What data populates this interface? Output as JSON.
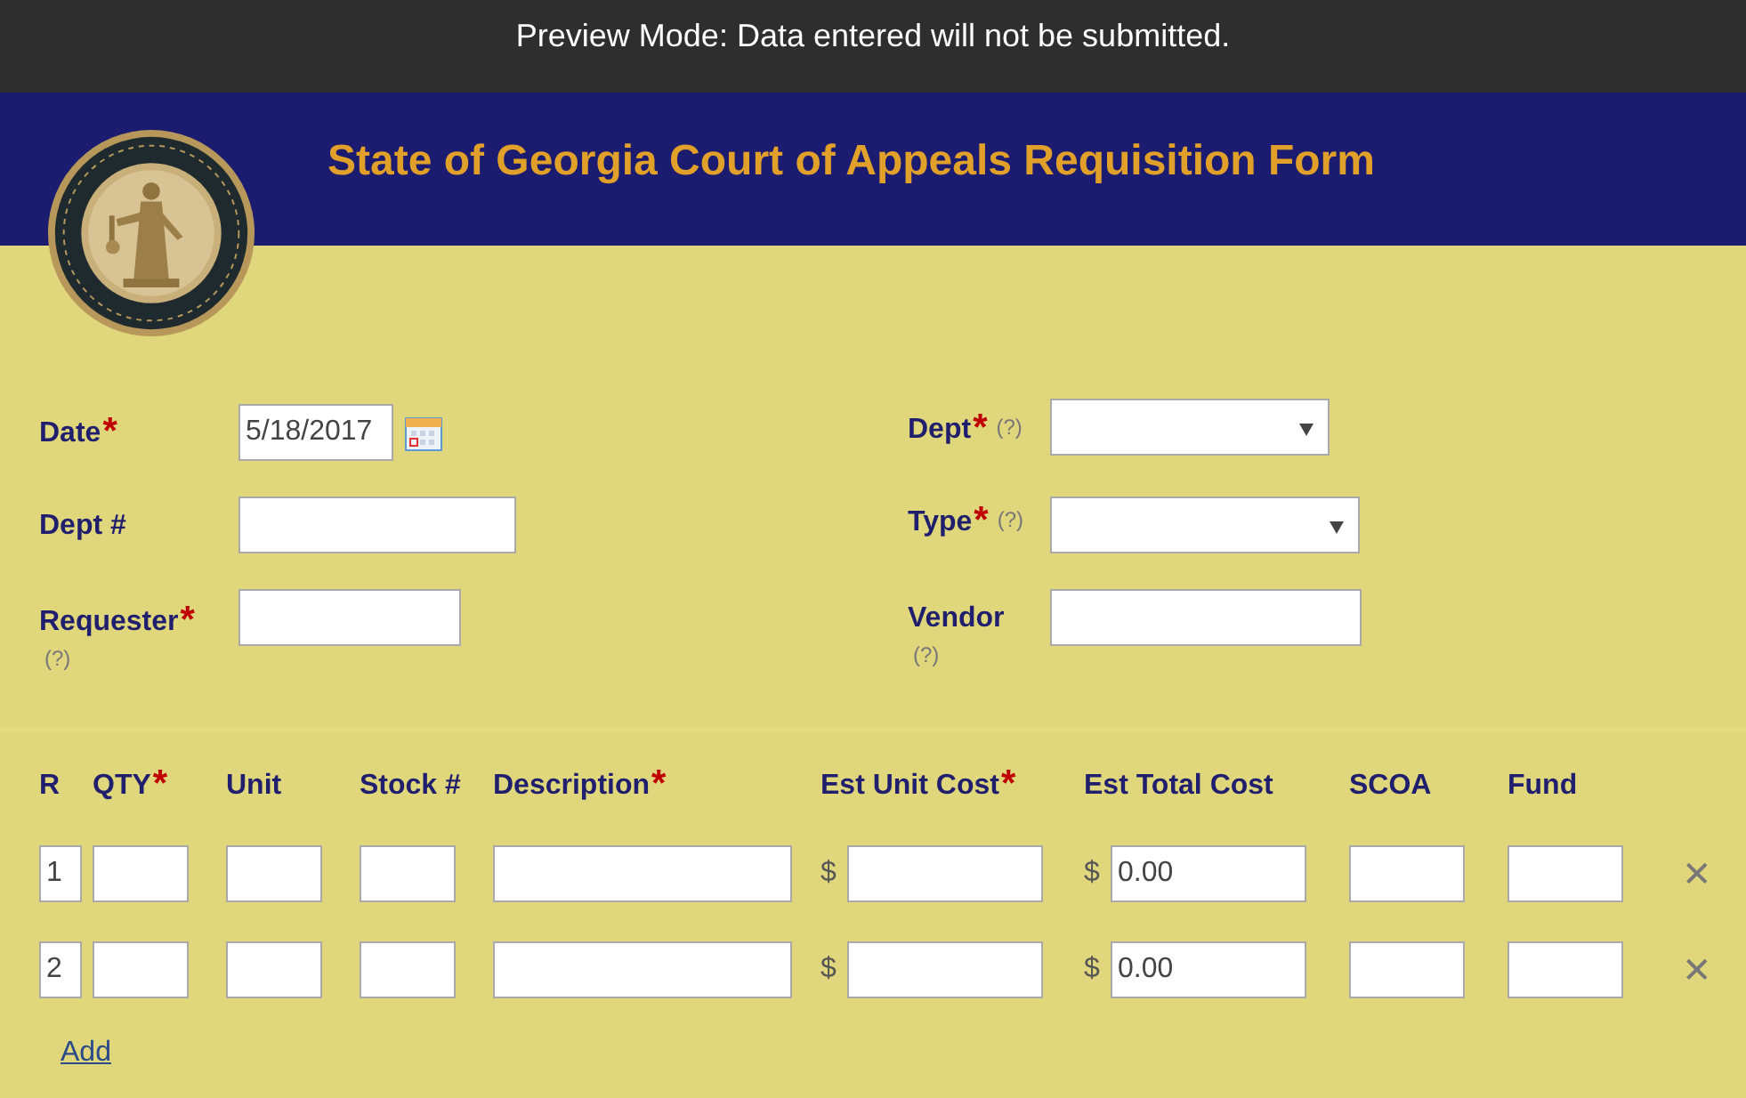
{
  "preview_banner": "Preview Mode: Data entered will not be submitted.",
  "header": {
    "title": "State of Georgia Court of Appeals Requisition Form"
  },
  "fields": [
    {
      "label": "Date",
      "required_mark": "*",
      "kind": "date",
      "value": "5/18/2017"
    },
    {
      "label": "Dept",
      "required_mark": "*",
      "kind": "select",
      "help": "(?)"
    },
    {
      "label": "Dept #",
      "kind": "text"
    },
    {
      "label": "Type",
      "required_mark": "*",
      "kind": "select",
      "help": "(?)"
    },
    {
      "label": "Requester",
      "required_mark": "*",
      "kind": "text",
      "help": "(?)"
    },
    {
      "label": "Vendor",
      "kind": "text",
      "help": "(?)"
    }
  ],
  "table": {
    "columns": [
      {
        "label": "R"
      },
      {
        "label": "QTY",
        "required_mark": "*"
      },
      {
        "label": "Unit"
      },
      {
        "label": "Stock #"
      },
      {
        "label": "Description",
        "required_mark": "*"
      },
      {
        "label": "Est Unit Cost",
        "required_mark": "*"
      },
      {
        "label": "Est Total Cost"
      },
      {
        "label": "SCOA"
      },
      {
        "label": "Fund"
      }
    ],
    "rows": [
      {
        "number": "1",
        "unit_cost_currency": "$",
        "total_cost_currency": "$",
        "est_total_cost": "0.00",
        "remove": "✕"
      },
      {
        "number": "2",
        "unit_cost_currency": "$",
        "total_cost_currency": "$",
        "est_total_cost": "0.00",
        "remove": "✕"
      }
    ]
  },
  "add_link": "Add"
}
